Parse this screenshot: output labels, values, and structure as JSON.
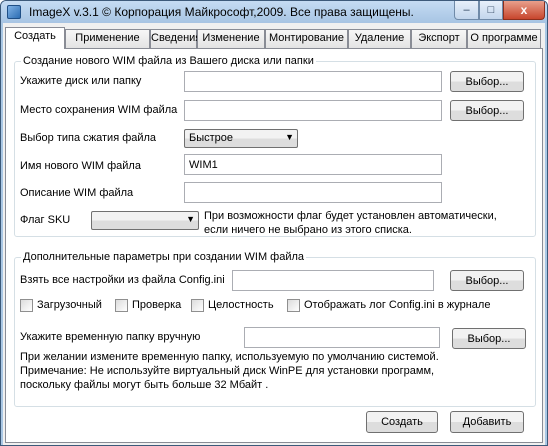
{
  "window": {
    "title": "ImageX v.3.1  © Корпорация Майкрософт,2009. Все права защищены.",
    "minimize_glyph": "–",
    "maximize_glyph": "□",
    "close_glyph": "x"
  },
  "tabs": [
    {
      "label": "Создать",
      "active": true
    },
    {
      "label": "Применение",
      "active": false
    },
    {
      "label": "Сведения",
      "active": false
    },
    {
      "label": "Изменение",
      "active": false
    },
    {
      "label": "Монтирование",
      "active": false
    },
    {
      "label": "Удаление",
      "active": false
    },
    {
      "label": "Экспорт",
      "active": false
    },
    {
      "label": "О программе",
      "active": false
    }
  ],
  "create_group": {
    "title": "Создание нового WIM файла из Вашего диска или папки",
    "source_label": "Укажите диск или папку",
    "source_value": "",
    "source_browse": "Выбор...",
    "dest_label": "Место сохранения WIM файла",
    "dest_value": "",
    "dest_browse": "Выбор...",
    "compression_label": "Выбор типа сжатия файла",
    "compression_value": "Быстрое",
    "name_label": "Имя нового WIM файла",
    "name_value": "WIM1",
    "description_label": "Описание WIM файла",
    "description_value": "",
    "sku_label": "Флаг SKU",
    "sku_value": "",
    "sku_note_line1": "При возможности флаг будет установлен автоматически,",
    "sku_note_line2": "если ничего не выбрано из этого списка."
  },
  "extra_group": {
    "title": "Дополнительные параметры при создании WIM файла",
    "config_label": "Взять все настройки из файла Config.ini",
    "config_value": "",
    "config_browse": "Выбор...",
    "checkboxes": [
      {
        "label": "Загрузочный",
        "checked": false
      },
      {
        "label": "Проверка",
        "checked": false
      },
      {
        "label": "Целостность",
        "checked": false
      },
      {
        "label": "Отображать лог Config.ini в журнале",
        "checked": false
      }
    ],
    "temp_label": "Укажите временную папку вручную",
    "temp_value": "",
    "temp_browse": "Выбор...",
    "note_lines": [
      "При желании измените временную папку, используемую по умолчанию системой.",
      "Примечание: Не используйте виртуальный диск WinPE для установки программ,",
      "поскольку файлы могут быть больше 32 Мбайт ."
    ]
  },
  "actions": {
    "create": "Создать",
    "add": "Добавить"
  }
}
